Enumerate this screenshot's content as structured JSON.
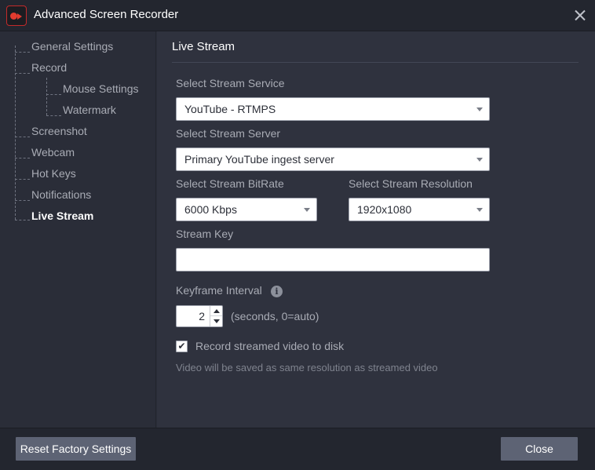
{
  "window": {
    "title": "Advanced Screen Recorder"
  },
  "sidebar": {
    "items": [
      {
        "label": "General Settings"
      },
      {
        "label": "Record"
      },
      {
        "label": "Mouse Settings"
      },
      {
        "label": "Watermark"
      },
      {
        "label": "Screenshot"
      },
      {
        "label": "Webcam"
      },
      {
        "label": "Hot Keys"
      },
      {
        "label": "Notifications"
      },
      {
        "label": "Live Stream"
      }
    ],
    "active": "Live Stream"
  },
  "main": {
    "title": "Live Stream",
    "stream_service": {
      "label": "Select Stream Service",
      "value": "YouTube - RTMPS"
    },
    "stream_server": {
      "label": "Select Stream Server",
      "value": "Primary YouTube ingest server"
    },
    "bitrate": {
      "label": "Select Stream BitRate",
      "value": "6000 Kbps"
    },
    "resolution": {
      "label": "Select Stream Resolution",
      "value": "1920x1080"
    },
    "stream_key": {
      "label": "Stream Key",
      "value": ""
    },
    "keyframe": {
      "label": "Keyframe Interval",
      "value": "2",
      "suffix": "(seconds, 0=auto)",
      "info_icon": "i"
    },
    "record_to_disk": {
      "label": "Record streamed video to disk",
      "checked": true,
      "check_glyph": "✔"
    },
    "hint": "Video will be saved as same resolution as streamed video"
  },
  "footer": {
    "reset_label": "Reset Factory Settings",
    "close_label": "Close"
  }
}
